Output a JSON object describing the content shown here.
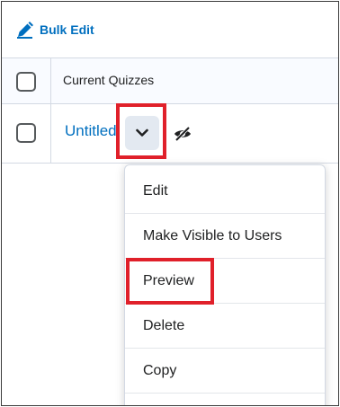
{
  "toolbar": {
    "bulk_edit_label": "Bulk Edit",
    "icon": "pencil-edit-icon"
  },
  "table": {
    "header_title": "Current Quizzes",
    "rows": [
      {
        "title": "Untitled"
      }
    ]
  },
  "menu": {
    "items": [
      {
        "label": "Edit"
      },
      {
        "label": "Make Visible to Users"
      },
      {
        "label": "Preview"
      },
      {
        "label": "Delete"
      },
      {
        "label": "Copy"
      }
    ]
  },
  "colors": {
    "accent": "#006fbf",
    "highlight": "#e0202a"
  }
}
